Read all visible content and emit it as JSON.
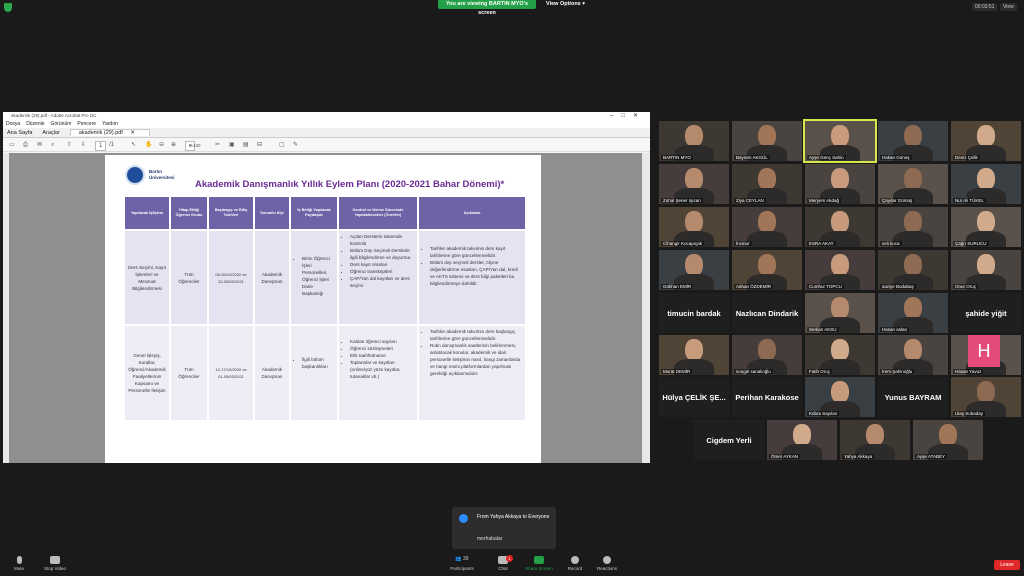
{
  "zoom": {
    "banner": "You are viewing BARTIN MYO's screen",
    "view_options": "View Options",
    "timer": "00:03:51",
    "view": "View"
  },
  "acrobat": {
    "title": "akademik (29).pdf - Adobe Acrobat Pro DC",
    "menu": [
      "Dosya",
      "Düzenle",
      "Görünüm",
      "Pencere",
      "Yardım"
    ],
    "tabs": [
      "Ana Sayfa",
      "Araçlar"
    ],
    "doc_tab": "akademik (29).pdf",
    "page_num": "1",
    "page_total": "1",
    "zoom": "%100"
  },
  "pdf": {
    "logo_text": [
      "Bartın",
      "Üniversitesi"
    ],
    "title": "Akademik Danışmanlık Yıllık Eylem Planı (2020-2021 Bahar Dönemi)*",
    "headers": [
      "Yapılacak İş/İşlem",
      "Hitap Ettiği Öğrenci Grubu",
      "Başlangıç ve Bitiş Tarihleri",
      "Sorumlu Kişi",
      "İş Birliği Yapılacak Paydaşlar",
      "Kontrol ve İzleme Sürecinde Yapılabilecekler (Öneriler)",
      "Açıklama"
    ],
    "row1": {
      "task": "Ders Seçimi, Kayıt İşlemleri ve Mevzuat Bilgilendirmesi",
      "group": "Tüm Öğrenciler",
      "dates": "05-09/10/2020 ve 22-26/02/2021",
      "owner": "Akademik Danışman",
      "partners": [
        "Birim Öğrenci İşleri Personelleri, Öğrenci İşleri Daire Başkanlığı"
      ],
      "suggestions": [
        "Açılan Derslerin sistemde kontrolü",
        "Bölüm Dışı Seçmeli Derslerle ilgili bilgilendirme ve duyurma",
        "Ders kayıt oranları",
        "Öğrenci transkriptleri",
        "ÇAP/Yan dal kayıtları ve ders seçimi"
      ],
      "notes": [
        "Tarihler akademik takvimin ders kayıt tarihlerine göre güncellenmelidir.",
        "Bölüm dışı seçmeli dersler, ölçme değerlendirme esasları, ÇAP/Yan dal, kredi ve AKTS sistemi ve ders bilgi paketleri bu bilgilendirmeye dahildir."
      ]
    },
    "row2": {
      "task": "Genel İşleyiş, Kurallar, Öğrenci/Akademik Faaliyetlerinin Kapsamı ve Personelle İletişim",
      "group": "Tüm Öğrenciler",
      "dates": "12-17/10/2020 ve 01-05/03/2021",
      "owner": "Akademik Danışman",
      "partners": [
        "İlgili bölüm başkanlıkları"
      ],
      "suggestions": [
        "Katılan öğrenci sayıları",
        "Öğrenci sözleşmeleri",
        "Etik taahhütname",
        "Toplantılar ve kayıtları (online/yüz yüze kayıtlar, tutanaklar vb.)"
      ],
      "notes": [
        "Tarihler akademik takvimin ders başlangıç tarihlerine göre güncellenmelidir.",
        "Rutin danışmanlık saatlerinin belirlenmesi, anlatılacak konular, akademik ve idari personelle iletişimin nasıl, hangi zamanlarda ve hangi resmi platformlardan yapılması gerektiği açıklanmalıdır."
      ]
    }
  },
  "participants": [
    "BARTIN MYO",
    "Bayram AKGÜL",
    "Ayşe Genç Sahin",
    "Hakan Güneş",
    "Deniz Çelik",
    "Zuhal Şener Işıcan",
    "Ziya CEYLAN",
    "Meryem Akdağ",
    "Çaydar Gümüş",
    "Nur Ali TÜKEL",
    "Cihangir Kocapıçak",
    "İncinur",
    "ESRA AKAY",
    "veli koca",
    "Çağrı SURUCU",
    "Gökhan EMİR",
    "Adnan ÖZDEMİR",
    "Cumhur TOPCU",
    "saziye Bodabaş",
    "Onur Oruç",
    "Serkan AKSU",
    "Hasan aslan",
    "Murat DEMİR",
    "songül sanalioğlu",
    "Fatih Oruç",
    "İrem Şahinoğlu",
    "Hasan Yavuz",
    "Kübra Sayılan",
    "Ulaş Sobaday",
    "Ömer AYKAN",
    "Yahya Akkaya",
    "Ayşe ATABEY"
  ],
  "name_tiles": [
    "timucin bardak",
    "Nazlıcan Dindarik",
    "şahide yiğit",
    "Hülya ÇELİK ŞE...",
    "Perihan Karakose",
    "Yunus BAYRAM",
    "Cigdem Yerli"
  ],
  "avatar_letter": "H",
  "chat": {
    "from": "From Yahya Akkaya to Everyone",
    "message": "merhabalar"
  },
  "bottom": {
    "mute": "Mute",
    "video": "Stop Video",
    "participants": "Participants",
    "participants_count": "39",
    "chat": "Chat",
    "chat_badge": "1",
    "share": "Share Screen",
    "record": "Record",
    "reactions": "Reactions",
    "leave": "Leave"
  },
  "colors": {
    "zoom_green": "#24a148",
    "leave_red": "#e02828",
    "header_purple": "#6d63a6",
    "title_purple": "#6a2b93"
  }
}
